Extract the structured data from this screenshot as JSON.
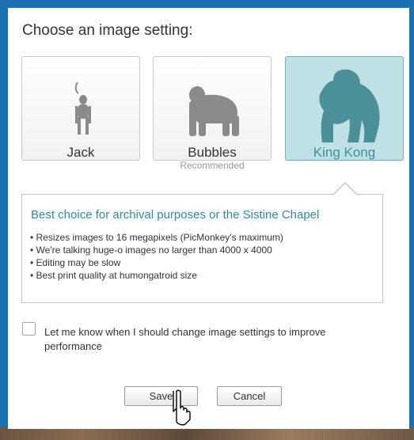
{
  "dialog": {
    "title": "Choose an image setting:"
  },
  "options": [
    {
      "name": "Jack",
      "sub": "",
      "icon": "monkey-icon",
      "selected": false
    },
    {
      "name": "Bubbles",
      "sub": "Recommended",
      "icon": "chimp-icon",
      "selected": false
    },
    {
      "name": "King Kong",
      "sub": "",
      "icon": "gorilla-icon",
      "selected": true
    }
  ],
  "info": {
    "title": "Best choice for archival purposes or the Sistine Chapel",
    "bullets": [
      "• Resizes images to 16 megapixels (PicMonkey's maximum)",
      "• We're talking huge-o images no larger than 4000 x 4000",
      "• Editing may be slow",
      "• Best print quality at humongatroid size"
    ]
  },
  "notify": {
    "label": "Let me know when I should change image settings to improve performance",
    "checked": false
  },
  "buttons": {
    "save": "Save",
    "cancel": "Cancel"
  },
  "colors": {
    "selected_bg": "#bfe1e6",
    "accent": "#3a8796",
    "frame": "#1a6fb0"
  }
}
